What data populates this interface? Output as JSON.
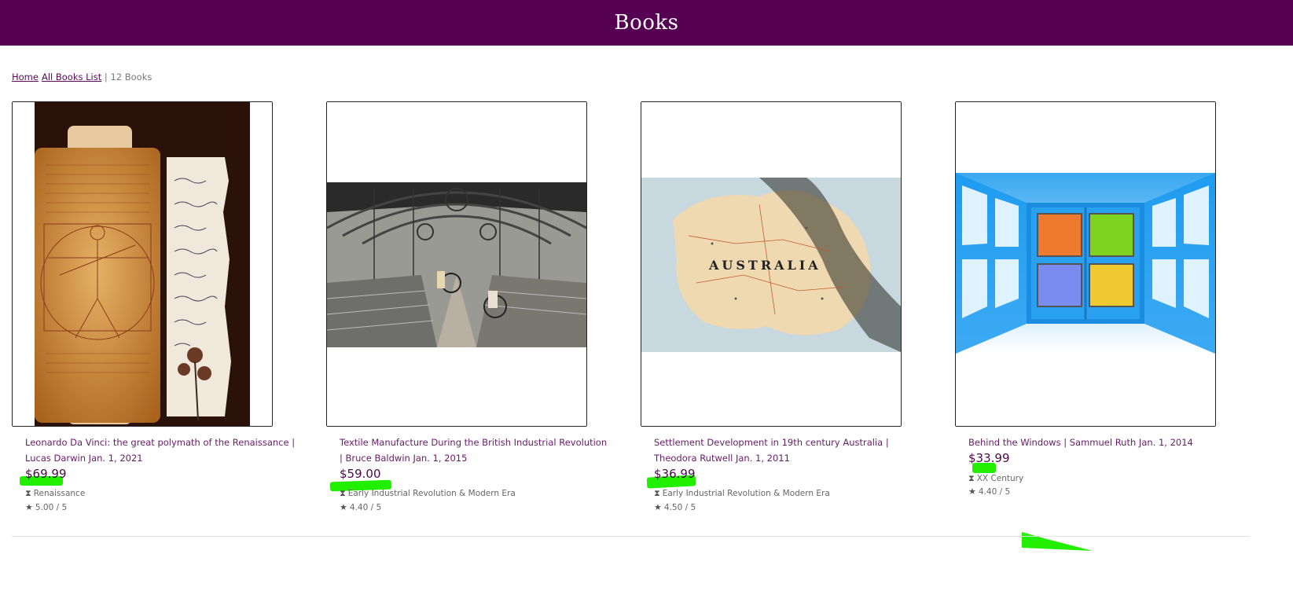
{
  "header": {
    "title": "Books"
  },
  "breadcrumb": {
    "home": "Home",
    "all_books": "All Books List",
    "separator": "|",
    "count": "12 Books"
  },
  "books": [
    {
      "title_line1": "Leonardo Da Vinci: the great polymath of the Renaissance |",
      "title_line2": "Lucas Darwin Jan. 1, 2021",
      "price": "$69.99",
      "era": "Renaissance",
      "rating": "5.00 / 5",
      "image": "vitruvian-man-manuscript"
    },
    {
      "title_line1": "Textile Manufacture During the British Industrial Revolution",
      "title_line2": "| Bruce Baldwin Jan. 1, 2015",
      "price": "$59.00",
      "era": "Early Industrial Revolution & Modern Era",
      "rating": "4.40 / 5",
      "image": "textile-mill-interior"
    },
    {
      "title_line1": "Settlement Development in 19th century Australia |",
      "title_line2": "Theodora Rutwell Jan. 1, 2011",
      "price": "$36.99",
      "era": "Early Industrial Revolution & Modern Era",
      "rating": "4.50 / 5",
      "image": "australia-map",
      "map_label": "AUSTRALIA"
    },
    {
      "title_line1": "Behind the Windows | Sammuel Ruth Jan. 1, 2014",
      "title_line2": "",
      "price": "$33.99",
      "era": "XX Century",
      "rating": "4.40 / 5",
      "image": "windows-logo"
    }
  ],
  "icons": {
    "era": "hourglass-icon",
    "rating": "star-icon"
  },
  "colors": {
    "header_bg": "#550052",
    "link": "#5a0a5a",
    "highlight": "#22ee00"
  }
}
